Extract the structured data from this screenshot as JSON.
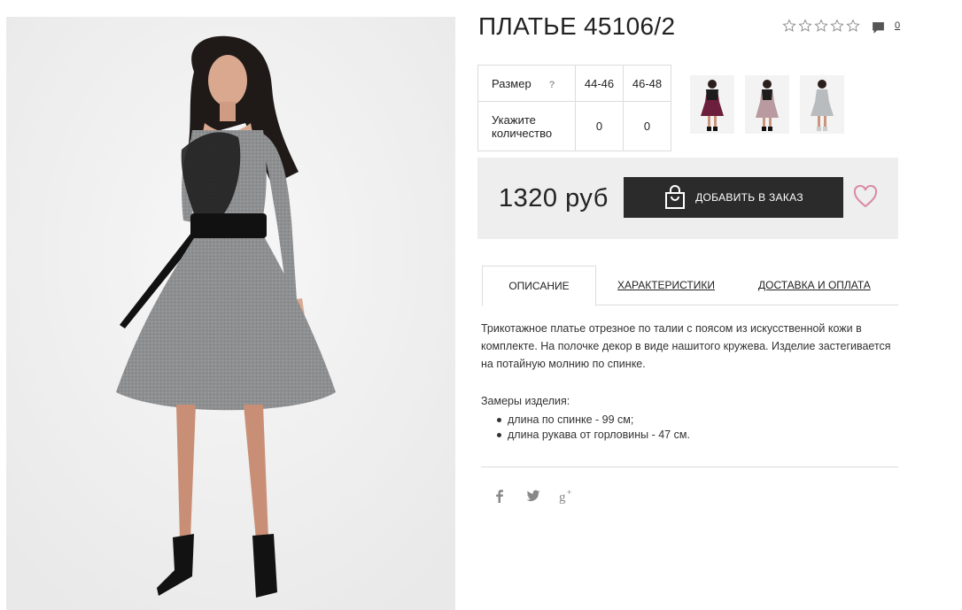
{
  "product": {
    "title": "ПЛАТЬЕ 45106/2",
    "rating_stars": 5,
    "rating_filled": 0,
    "comments_count": "0"
  },
  "size_table": {
    "size_label": "Размер",
    "help_mark": "?",
    "sizes": [
      "44-46",
      "46-48"
    ],
    "qty_label_line1": "Укажите",
    "qty_label_line2": "количество",
    "quantities": [
      "0",
      "0"
    ]
  },
  "thumbnails": [
    {
      "color": "#6b1f3c"
    },
    {
      "color": "#b89aa0"
    },
    {
      "color": "#b9bcbf"
    }
  ],
  "price": {
    "value": "1320 руб",
    "order_button": "ДОБАВИТЬ В ЗАКАЗ"
  },
  "tabs": {
    "description": "ОПИСАНИЕ",
    "characteristics": "ХАРАКТЕРИСТИКИ",
    "delivery": "ДОСТАВКА И ОПЛАТА"
  },
  "description": {
    "text": "Трикотажное платье отрезное по талии с поясом из искусственной кожи в комплекте. На полочке декор в виде нашитого кружева. Изделие застегивается на потайную молнию по спинке.",
    "measures_title": "Замеры изделия:",
    "measures": [
      "длина по спинке - 99 см;",
      "длина рукава от горловины - 47 см."
    ]
  },
  "social": [
    "facebook-icon",
    "twitter-icon",
    "google-plus-icon"
  ],
  "colors": {
    "accent_heart": "#d98aa3",
    "button_bg": "#2b2b2b",
    "price_bg": "#eeeeee"
  }
}
